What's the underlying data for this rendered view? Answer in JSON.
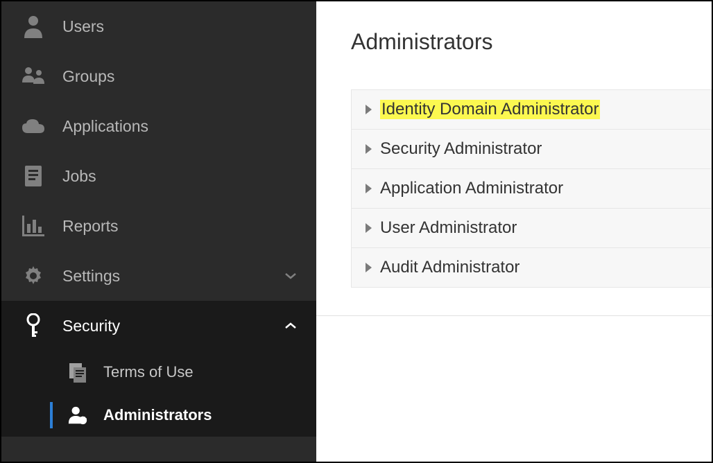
{
  "sidebar": {
    "items": [
      {
        "label": "Users",
        "icon": "user"
      },
      {
        "label": "Groups",
        "icon": "groups"
      },
      {
        "label": "Applications",
        "icon": "cloud"
      },
      {
        "label": "Jobs",
        "icon": "clipboard"
      },
      {
        "label": "Reports",
        "icon": "barchart"
      },
      {
        "label": "Settings",
        "icon": "gear",
        "chevron": "down"
      },
      {
        "label": "Security",
        "icon": "key",
        "chevron": "up",
        "expanded": true
      }
    ],
    "subitems": [
      {
        "label": "Terms of Use",
        "icon": "docs",
        "selected": false
      },
      {
        "label": "Administrators",
        "icon": "usercog",
        "selected": true
      }
    ]
  },
  "main": {
    "title": "Administrators",
    "rows": [
      {
        "label": "Identity Domain Administrator",
        "highlighted": true
      },
      {
        "label": "Security Administrator",
        "highlighted": false
      },
      {
        "label": "Application Administrator",
        "highlighted": false
      },
      {
        "label": "User Administrator",
        "highlighted": false
      },
      {
        "label": "Audit Administrator",
        "highlighted": false
      }
    ]
  }
}
